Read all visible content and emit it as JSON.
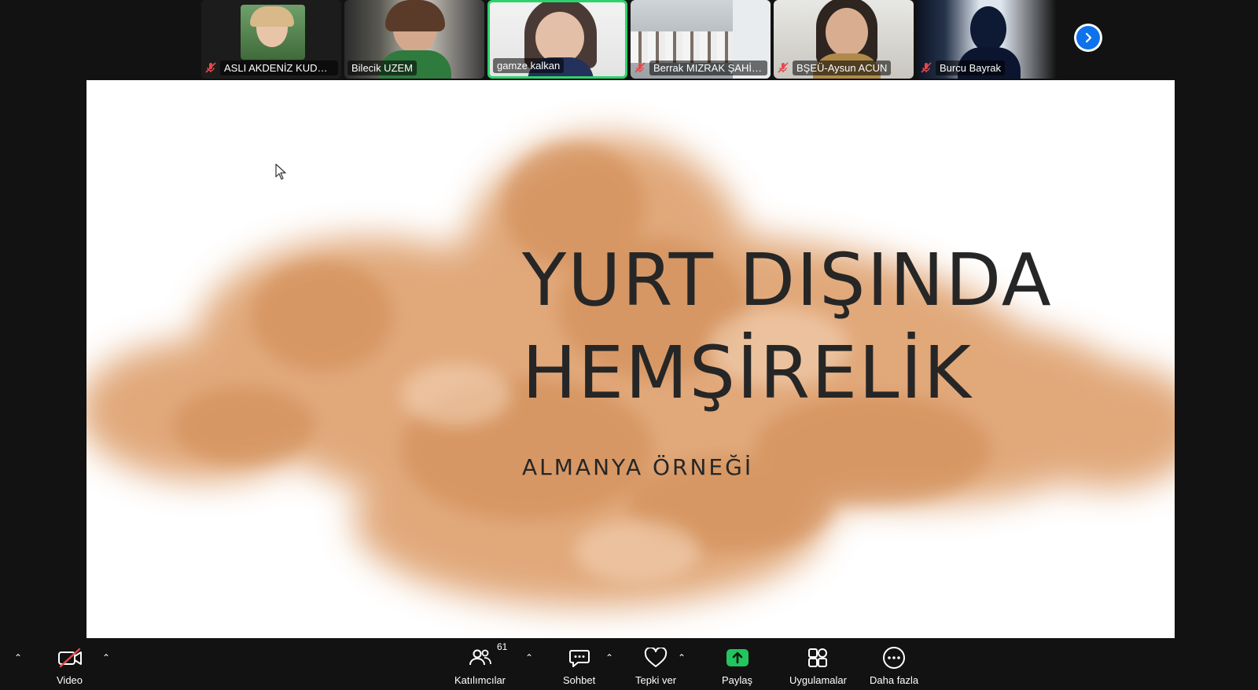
{
  "participants": [
    {
      "name": "ASLI AKDENİZ KUDUB...",
      "muted": true
    },
    {
      "name": "Bilecik UZEM",
      "muted": false
    },
    {
      "name": "gamze kalkan",
      "muted": false,
      "active": true
    },
    {
      "name": "Berrak MIZRAK ŞAHİN...",
      "muted": true
    },
    {
      "name": "BŞEÜ-Aysun ACUN",
      "muted": true
    },
    {
      "name": "Burcu Bayrak",
      "muted": true
    }
  ],
  "slide": {
    "title_line1": "YURT DIŞINDA",
    "title_line2": "HEMŞİRELİK",
    "subtitle": "ALMANYA ÖRNEĞİ"
  },
  "toolbar": {
    "video_label": "Video",
    "participants_label": "Katılımcılar",
    "participants_count": "61",
    "chat_label": "Sohbet",
    "react_label": "Tepki ver",
    "share_label": "Paylaş",
    "apps_label": "Uygulamalar",
    "more_label": "Daha fazla"
  },
  "icons": {
    "mic_off": "mic-off-icon",
    "next": "chevron-right-icon",
    "video_off": "video-off-icon",
    "participants": "people-icon",
    "chat": "chat-icon",
    "react": "heart-icon",
    "share": "share-arrow-icon",
    "apps": "apps-icon",
    "more": "more-icon"
  },
  "colors": {
    "active_border": "#2bd46a",
    "share_green": "#22c55e",
    "muted_red": "#e5484d",
    "next_blue": "#0e72ed",
    "smoke": "#d9925a"
  }
}
